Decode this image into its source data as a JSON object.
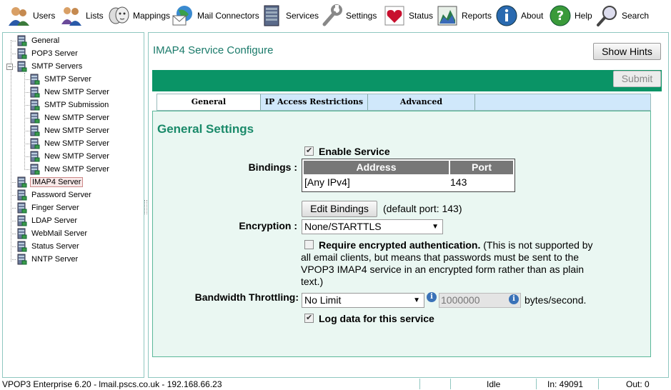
{
  "toolbar": {
    "items": [
      {
        "label": "Users",
        "icon": "users-icon"
      },
      {
        "label": "Lists",
        "icon": "lists-icon"
      },
      {
        "label": "Mappings",
        "icon": "mappings-icon"
      },
      {
        "label": "Mail Connectors",
        "icon": "mail-connectors-icon"
      },
      {
        "label": "Services",
        "icon": "services-icon"
      },
      {
        "label": "Settings",
        "icon": "settings-icon"
      },
      {
        "label": "Status",
        "icon": "status-icon"
      },
      {
        "label": "Reports",
        "icon": "reports-icon"
      },
      {
        "label": "About",
        "icon": "about-icon"
      },
      {
        "label": "Help",
        "icon": "help-icon"
      },
      {
        "label": "Search",
        "icon": "search-icon"
      }
    ]
  },
  "tree": {
    "items": [
      {
        "label": "General",
        "icon": "server-icon",
        "level": 0
      },
      {
        "label": "POP3 Server",
        "icon": "server-icon",
        "level": 0
      },
      {
        "label": "SMTP Servers",
        "icon": "server-icon",
        "level": 0,
        "expanded": true
      },
      {
        "label": "SMTP Server",
        "icon": "server-icon",
        "level": 1
      },
      {
        "label": "New SMTP Server",
        "icon": "server-icon",
        "level": 1
      },
      {
        "label": "SMTP Submission",
        "icon": "server-icon",
        "level": 1
      },
      {
        "label": "New SMTP Server",
        "icon": "server-icon",
        "level": 1
      },
      {
        "label": "New SMTP Server",
        "icon": "server-icon",
        "level": 1
      },
      {
        "label": "New SMTP Server",
        "icon": "server-icon",
        "level": 1
      },
      {
        "label": "New SMTP Server",
        "icon": "server-icon",
        "level": 1
      },
      {
        "label": "New SMTP Server",
        "icon": "server-icon",
        "level": 1
      },
      {
        "label": "IMAP4 Server",
        "icon": "server-icon",
        "level": 0,
        "selected": true
      },
      {
        "label": "Password Server",
        "icon": "server-icon",
        "level": 0
      },
      {
        "label": "Finger Server",
        "icon": "server-icon",
        "level": 0
      },
      {
        "label": "LDAP Server",
        "icon": "server-icon",
        "level": 0
      },
      {
        "label": "WebMail Server",
        "icon": "server-icon",
        "level": 0
      },
      {
        "label": "Status Server",
        "icon": "server-icon",
        "level": 0
      },
      {
        "label": "NNTP Server",
        "icon": "server-icon",
        "level": 0
      }
    ]
  },
  "main": {
    "title": "IMAP4 Service Configure",
    "show_hints_label": "Show Hints",
    "submit_label": "Submit",
    "tabs": [
      {
        "label": "General",
        "active": true
      },
      {
        "label": "IP Access Restrictions",
        "active": false
      },
      {
        "label": "Advanced",
        "active": false
      }
    ],
    "section_title": "General Settings",
    "enable_service_label": "Enable Service",
    "enable_service_checked": true,
    "bindings_label": "Bindings :",
    "bindings_table": {
      "headers": [
        "Address",
        "Port"
      ],
      "rows": [
        [
          "[Any IPv4]",
          "143"
        ]
      ]
    },
    "edit_bindings_label": "Edit Bindings",
    "default_port_text": "(default port: 143)",
    "encryption_label": "Encryption :",
    "encryption_value": "None/STARTTLS",
    "require_auth_label": "Require encrypted authentication.",
    "require_auth_checked": false,
    "require_auth_note_line1": "(This is not supported by",
    "require_auth_note_line2": "all email clients, but means that passwords must be sent to the",
    "require_auth_note_line3": "VPOP3 IMAP4 service in an encrypted form rather than as plain",
    "require_auth_note_line4": "text.)",
    "bandwidth_label": "Bandwidth Throttling:",
    "bandwidth_value": "No Limit",
    "bandwidth_input_value": "1000000",
    "bandwidth_unit": "bytes/second.",
    "log_data_label": "Log data for this service",
    "log_data_checked": true
  },
  "statusbar": {
    "product": "VPOP3 Enterprise 6.20 - lmail.pscs.co.uk - 192.168.66.23",
    "state": "Idle",
    "in": "In: 49091",
    "out": "Out: 0"
  },
  "colors": {
    "accent_green": "#0a9466",
    "title_teal": "#1a7a6a",
    "tab_bg": "#d0e8fb",
    "content_bg": "#eaf7f2"
  }
}
